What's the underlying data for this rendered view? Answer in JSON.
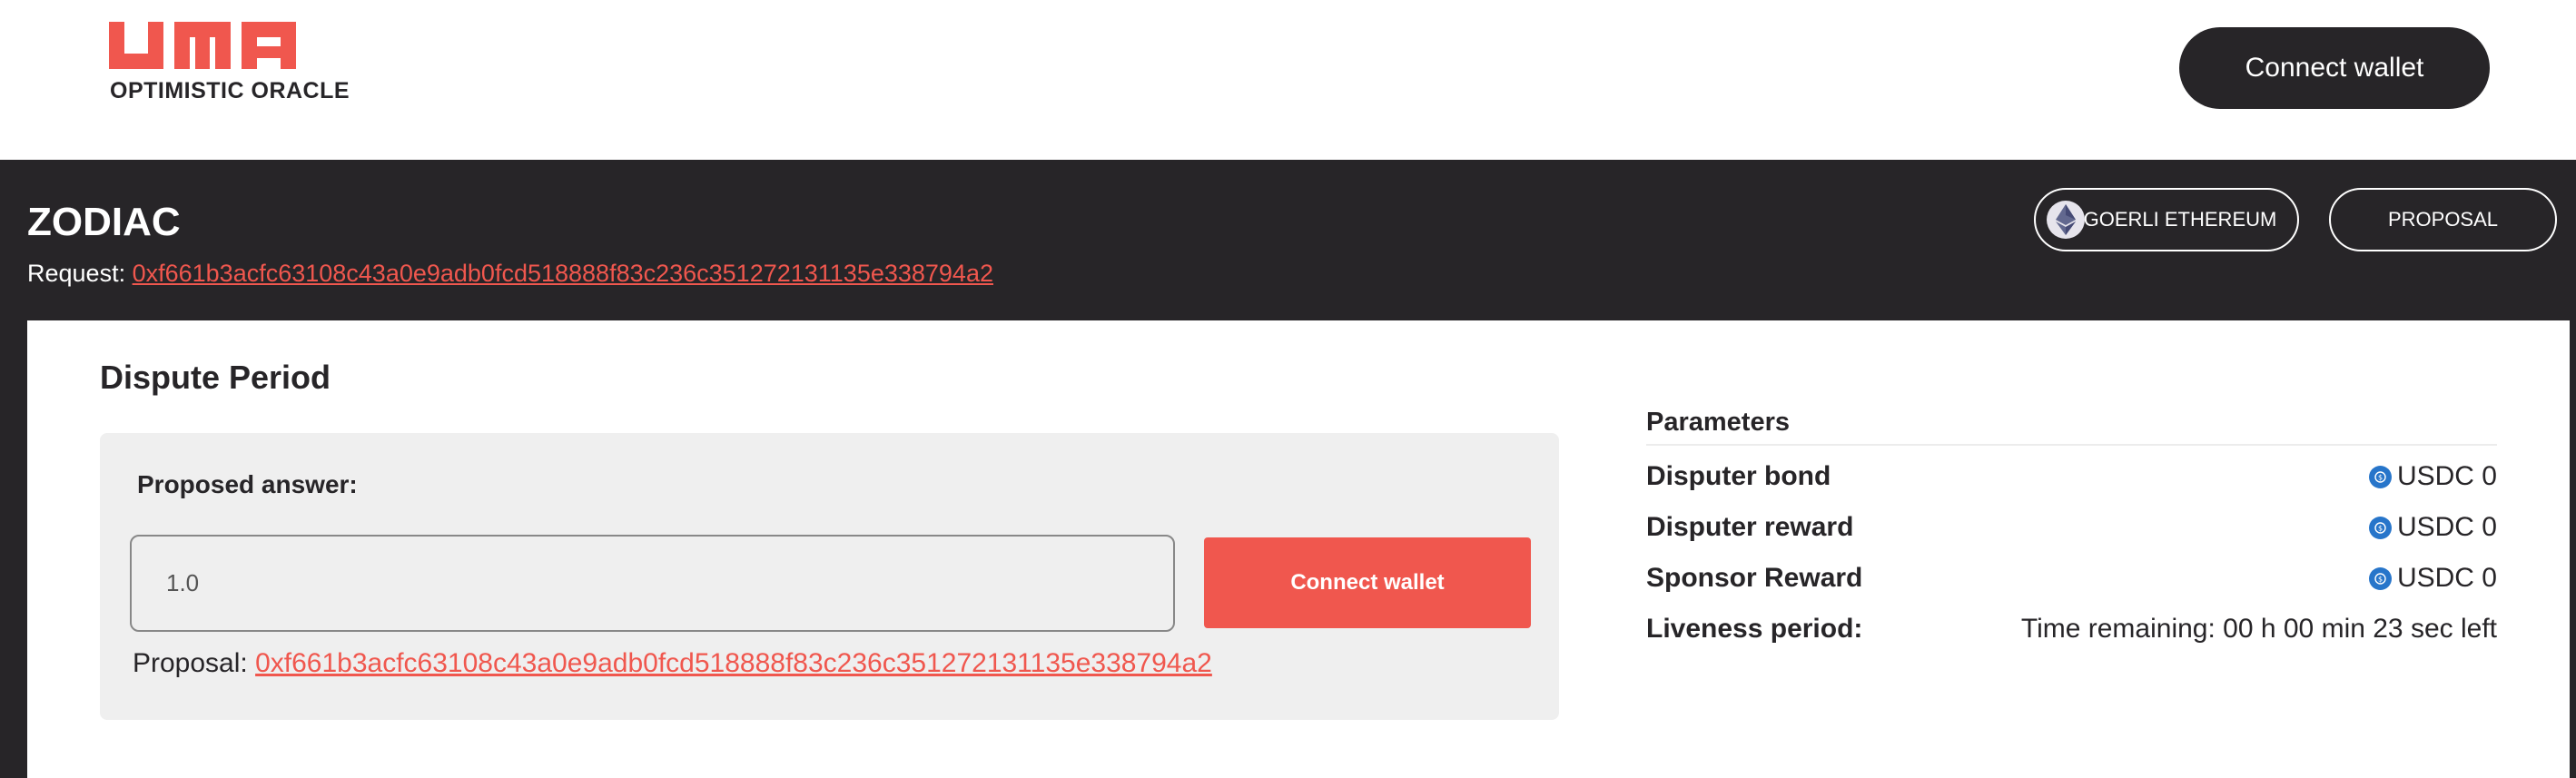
{
  "brand": {
    "logo_text": "UMA",
    "subtitle": "OPTIMISTIC ORACLE",
    "accent_color": "#f0574e",
    "dark_color": "#272528"
  },
  "header": {
    "connect_wallet_label": "Connect wallet"
  },
  "request": {
    "title": "ZODIAC",
    "label": "Request:",
    "id": "0xf661b3acfc63108c43a0e9adb0fcd518888f83c236c351272131135e338794a2",
    "network_label": "GOERLI ETHEREUM",
    "network_icon": "ethereum-icon",
    "type_label": "PROPOSAL"
  },
  "dispute": {
    "title": "Dispute Period",
    "proposed_answer_label": "Proposed answer:",
    "proposed_answer_value": "1.0",
    "connect_wallet_label": "Connect wallet",
    "proposal_label": "Proposal:",
    "proposal_id": "0xf661b3acfc63108c43a0e9adb0fcd518888f83c236c351272131135e338794a2"
  },
  "parameters": {
    "title": "Parameters",
    "rows": [
      {
        "label": "Disputer bond",
        "value": "USDC 0",
        "icon": "usdc-icon"
      },
      {
        "label": "Disputer reward",
        "value": "USDC 0",
        "icon": "usdc-icon"
      },
      {
        "label": "Sponsor Reward",
        "value": "USDC 0",
        "icon": "usdc-icon"
      },
      {
        "label": "Liveness period:",
        "value": "Time remaining: 00 h 00 min 23 sec left"
      }
    ]
  }
}
